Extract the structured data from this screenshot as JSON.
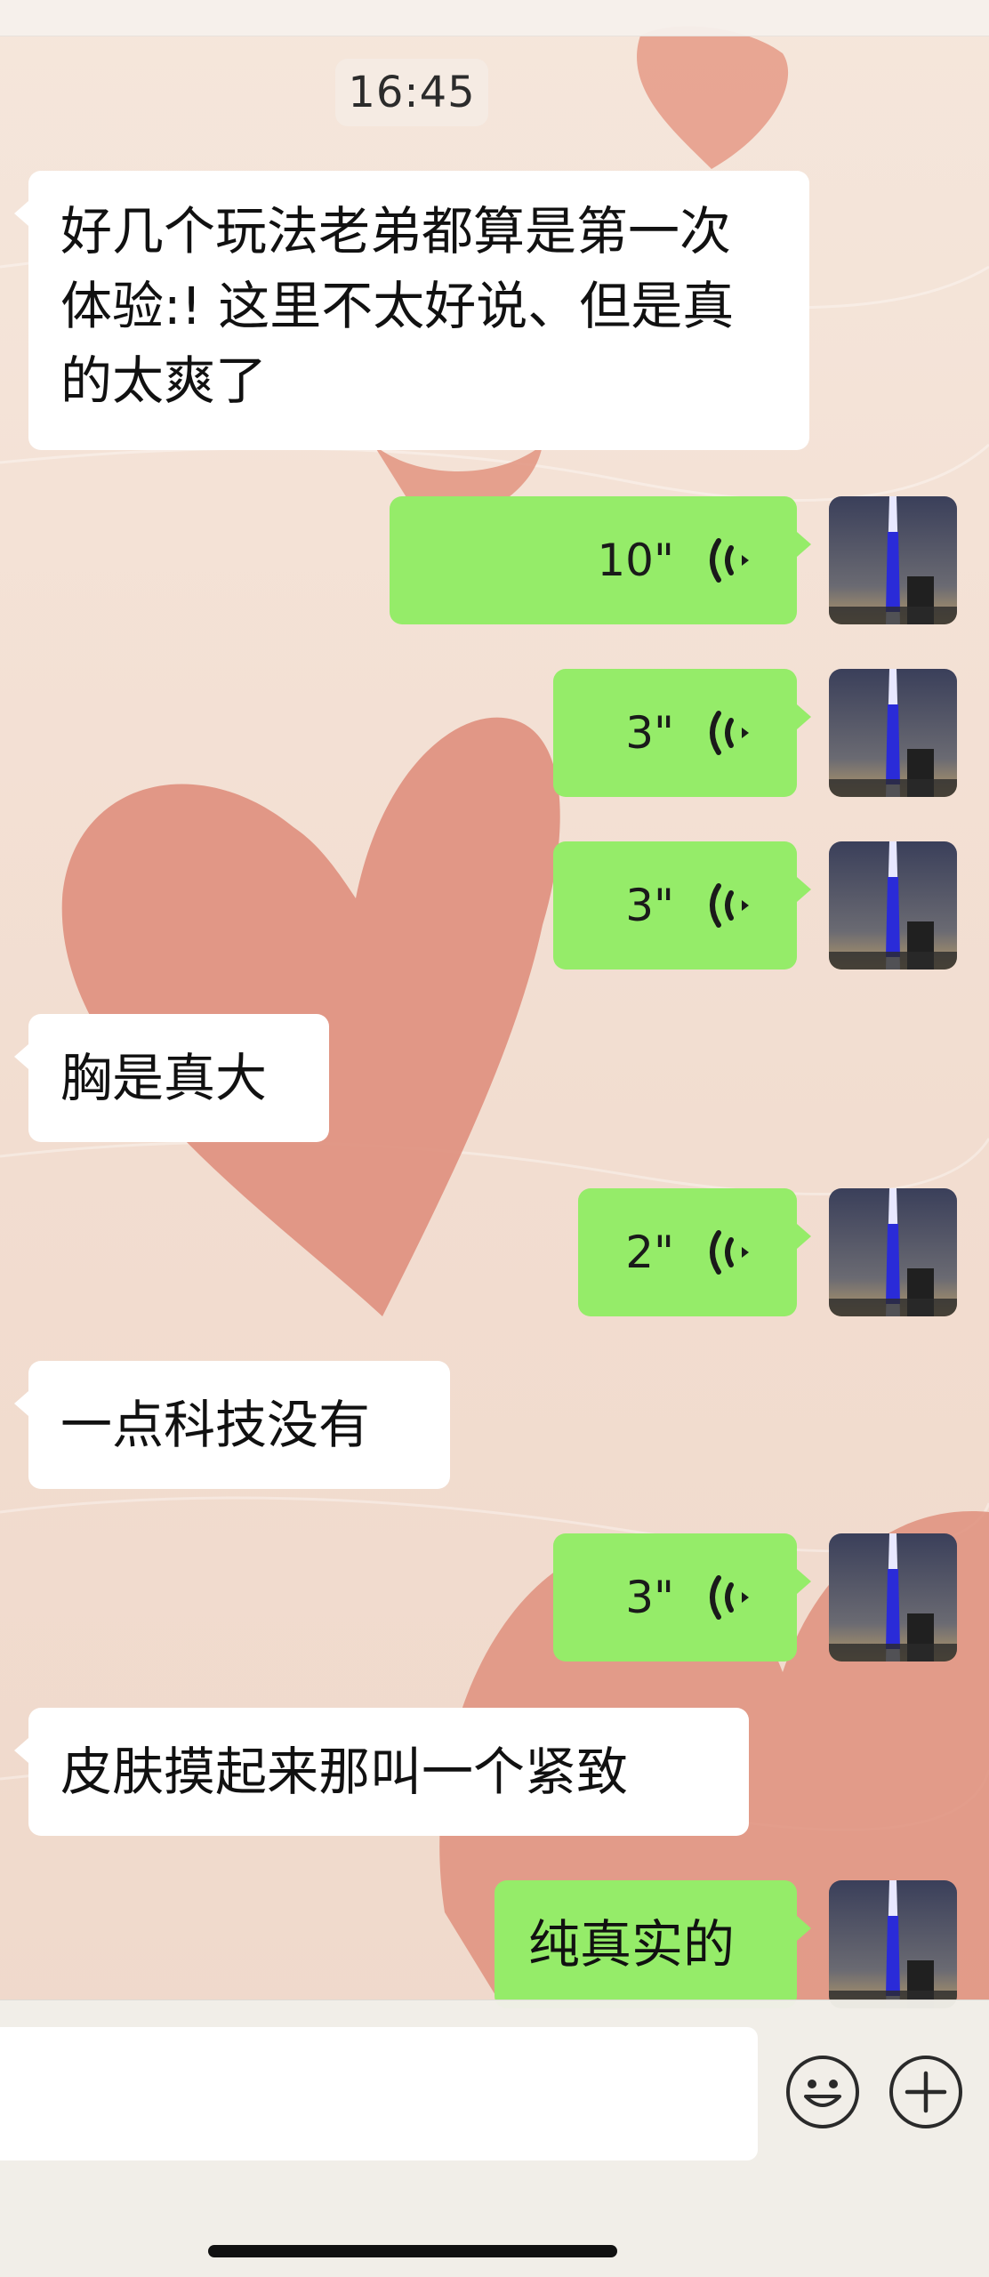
{
  "chat": {
    "timestamp": "16:45",
    "messages": [
      {
        "side": "in",
        "text": "好几个玩法老弟都算是第一次体验:! 这里不太好说、但是真的太爽了"
      },
      {
        "side": "out",
        "voice": "10\""
      },
      {
        "side": "out",
        "voice": "3\""
      },
      {
        "side": "out",
        "voice": "3\""
      },
      {
        "side": "in",
        "text": "胸是真大"
      },
      {
        "side": "out",
        "voice": "2\""
      },
      {
        "side": "in",
        "text": "一点科技没有"
      },
      {
        "side": "out",
        "voice": "3\""
      },
      {
        "side": "in",
        "text": "皮肤摸起来那叫一个紧致"
      },
      {
        "side": "out",
        "text": "纯真实的"
      }
    ]
  },
  "icons": {
    "voice": "voice-wave-icon",
    "emoji": "emoji-icon",
    "plus": "plus-icon"
  },
  "colors": {
    "outgoing_bubble": "#95ec69",
    "incoming_bubble": "#ffffff",
    "wallpaper_base": "#f3e1d4",
    "heart": "#df8f7d"
  }
}
